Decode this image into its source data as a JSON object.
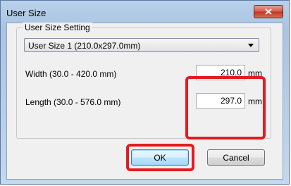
{
  "dialog": {
    "title": "User Size",
    "close_icon": "close-icon",
    "close_color": "#c0392b"
  },
  "group": {
    "label": "User Size Setting",
    "selected_option": "User Size 1 (210.0x297.0mm)"
  },
  "width": {
    "label": "Width (30.0 - 420.0 mm)",
    "value": "210.0",
    "unit": "mm"
  },
  "length": {
    "label": "Length (30.0 - 576.0 mm)",
    "value": "297.0",
    "unit": "mm"
  },
  "buttons": {
    "ok": "OK",
    "cancel": "Cancel"
  },
  "highlight_color": "#e31b23"
}
